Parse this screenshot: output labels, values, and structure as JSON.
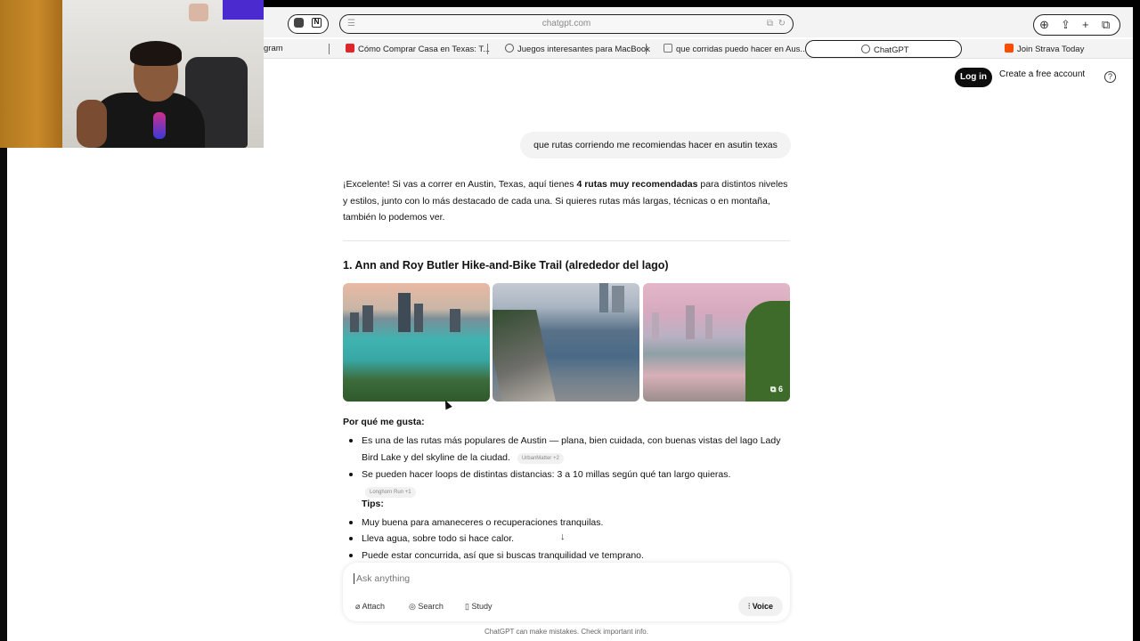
{
  "browser": {
    "url": "chatgpt.com",
    "bookmarks": [
      {
        "label": "gram"
      },
      {
        "label": "Cómo Comprar Casa en Texas: T..."
      },
      {
        "label": "Juegos interesantes para MacBook"
      },
      {
        "label": "que corridas puedo hacer en Aus..."
      },
      {
        "label": "ChatGPT"
      },
      {
        "label": "Join Strava Today"
      }
    ]
  },
  "header": {
    "login": "Log in",
    "create_account": "Create a free account",
    "help": "?"
  },
  "chat": {
    "user_message": "que rutas corriendo me recomiendas hacer en asutin texas",
    "intro_pre": "¡Excelente! Si vas a correr en Austin, Texas, aquí tienes ",
    "intro_bold": "4 rutas muy recomendadas",
    "intro_post": " para distintos niveles y estilos, junto con lo más destacado de cada una. Si quieres rutas más largas, técnicas o en montaña, también lo podemos ver.",
    "section_title": "1. Ann and Roy Butler Hike-and-Bike Trail (alrededor del lago)",
    "photo_count": "6",
    "why_title": "Por qué me gusta:",
    "why_bullets": [
      {
        "text": "Es una de las rutas más populares de Austin — plana, bien cuidada, con buenas vistas del lago Lady Bird Lake y del skyline de la ciudad.",
        "chip": "UrbanMatter +2"
      },
      {
        "text": "Se pueden hacer loops de distintas distancias: 3 a 10 millas según qué tan largo quieras.",
        "chip": "Longhorn Run +1"
      }
    ],
    "tips_title": "Tips:",
    "tips": [
      "Muy buena para amaneceres o recuperaciones tranquilas.",
      "Lleva agua, sobre todo si hace calor.",
      "Puede estar concurrida, así que si buscas tranquilidad ve temprano."
    ]
  },
  "composer": {
    "placeholder": "Ask anything",
    "attach": "Attach",
    "search": "Search",
    "study": "Study",
    "voice": "Voice"
  },
  "footer": "ChatGPT can make mistakes. Check important info."
}
